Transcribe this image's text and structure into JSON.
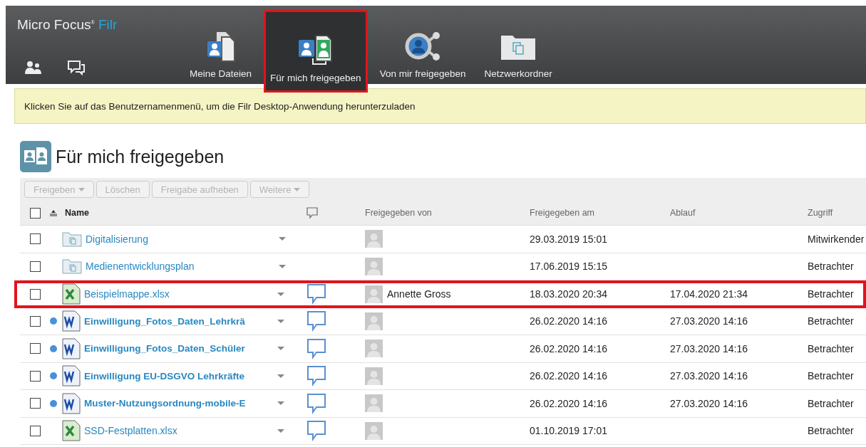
{
  "header": {
    "brand": "Micro Focus$^{®}$",
    "product": "Filr",
    "tabs": [
      {
        "label": "Meine Dateien",
        "kind": "files",
        "selected": false,
        "annotated": false
      },
      {
        "label": "Für mich freigegeben",
        "kind": "shared-with-me",
        "selected": true,
        "annotated": true
      },
      {
        "label": "Von mir freigegeben",
        "kind": "shared-by-me",
        "selected": false,
        "annotated": false
      },
      {
        "label": "Netzwerkordner",
        "kind": "network",
        "selected": false,
        "annotated": false
      }
    ]
  },
  "banner": "Klicken Sie auf das Benutzernamenmenü, um die Filr Desktop-Anwendung herunterzuladen",
  "page_title": "Für mich freigegeben",
  "toolbar": [
    {
      "label": "Freigeben",
      "dropdown": true,
      "disabled": true
    },
    {
      "label": "Löschen",
      "dropdown": false,
      "disabled": true
    },
    {
      "label": "Freigabe aufheben",
      "dropdown": false,
      "disabled": true
    },
    {
      "label": "Weitere",
      "dropdown": true,
      "disabled": true
    }
  ],
  "table": {
    "columns": [
      "Name",
      "Freigegeben von",
      "Freigegeben am",
      "Ablauf",
      "Zugriff"
    ],
    "select_all": {
      "checked": false
    },
    "rows": [
      {
        "kind": "folder",
        "name": "Digitalisierung",
        "unread": false,
        "comments": false,
        "shared_by": "",
        "shared_on": "29.03.2019 15:01",
        "expires": "",
        "access": "Mitwirkender",
        "checked": false,
        "annotated": false
      },
      {
        "kind": "folder",
        "name": "Medienentwicklungsplan",
        "unread": false,
        "comments": false,
        "shared_by": "",
        "shared_on": "17.06.2019 15:15",
        "expires": "",
        "access": "Betrachter",
        "checked": false,
        "annotated": false
      },
      {
        "kind": "xlsx",
        "name": "Beispielmappe.xlsx",
        "unread": false,
        "comments": true,
        "shared_by": "Annette Gross",
        "shared_on": "18.03.2020 20:34",
        "expires": "17.04.2020 21:34",
        "access": "Betrachter",
        "checked": false,
        "annotated": true
      },
      {
        "kind": "docx",
        "name": "Einwilligung_Fotos_Daten_Lehrkrä",
        "unread": true,
        "comments": true,
        "shared_by": "",
        "shared_on": "26.02.2020 14:16",
        "expires": "27.03.2020 14:16",
        "access": "Betrachter",
        "checked": false,
        "annotated": false
      },
      {
        "kind": "docx",
        "name": "Einwilligung_Fotos_Daten_Schüler",
        "unread": true,
        "comments": true,
        "shared_by": "",
        "shared_on": "26.02.2020 14:16",
        "expires": "27.03.2020 14:16",
        "access": "Betrachter",
        "checked": false,
        "annotated": false
      },
      {
        "kind": "docx",
        "name": "Einwilligung EU-DSGVO Lehrkräfte",
        "unread": true,
        "comments": true,
        "shared_by": "",
        "shared_on": "26.02.2020 14:16",
        "expires": "27.03.2020 14:16",
        "access": "Betrachter",
        "checked": false,
        "annotated": false
      },
      {
        "kind": "docx",
        "name": "Muster-Nutzungsordnung-mobile-E",
        "unread": true,
        "comments": true,
        "shared_by": "",
        "shared_on": "26.02.2020 14:16",
        "expires": "27.03.2020 14:16",
        "access": "Betrachter",
        "checked": false,
        "annotated": false
      },
      {
        "kind": "xlsx",
        "name": "SSD-Festplatten.xlsx",
        "unread": false,
        "comments": true,
        "shared_by": "",
        "shared_on": "01.10.2019 17:01",
        "expires": "",
        "access": "Betrachter",
        "checked": false,
        "annotated": false
      }
    ]
  }
}
